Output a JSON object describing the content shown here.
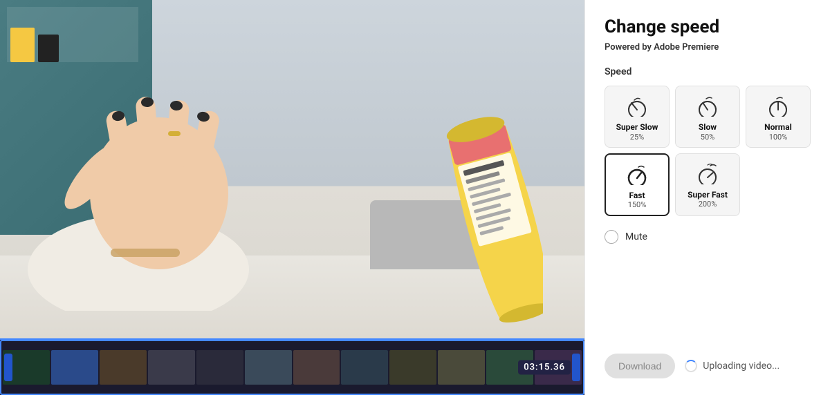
{
  "panel": {
    "title": "Change speed",
    "subtitle_prefix": "Powered by ",
    "subtitle_brand": "Adobe Premiere",
    "speed_label": "Speed"
  },
  "speed_options": [
    {
      "id": "super-slow",
      "name": "Super Slow",
      "pct": "25%",
      "selected": false,
      "icon": "turtle"
    },
    {
      "id": "slow",
      "name": "Slow",
      "pct": "50%",
      "selected": false,
      "icon": "slow"
    },
    {
      "id": "normal",
      "name": "Normal",
      "pct": "100%",
      "selected": false,
      "icon": "normal"
    },
    {
      "id": "fast",
      "name": "Fast",
      "pct": "150%",
      "selected": true,
      "icon": "fast"
    },
    {
      "id": "super-fast",
      "name": "Super Fast",
      "pct": "200%",
      "selected": false,
      "icon": "superfast"
    }
  ],
  "mute": {
    "label": "Mute",
    "checked": false
  },
  "actions": {
    "download_label": "Download",
    "uploading_label": "Uploading video..."
  },
  "timeline": {
    "timecode": "03:15.36"
  }
}
